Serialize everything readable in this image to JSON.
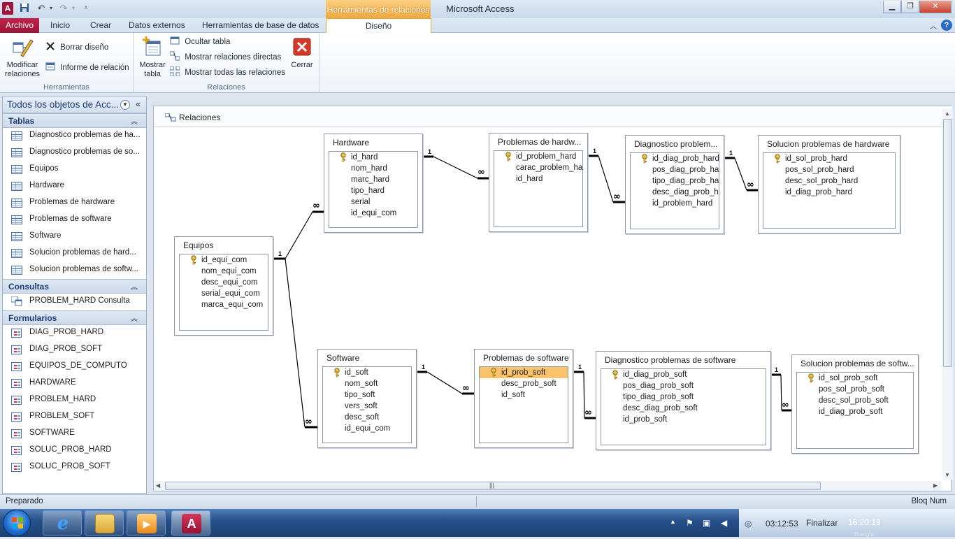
{
  "titlebar": {
    "app_icon_letter": "A",
    "context_tab": "Herramientas de relaciones",
    "app_title": "Microsoft Access",
    "minimize_glyph": "▁",
    "restore_glyph": "❐",
    "close_glyph": "✕"
  },
  "tabs": {
    "archivo": "Archivo",
    "inicio": "Inicio",
    "crear": "Crear",
    "datos_externos": "Datos externos",
    "herramientas_bd": "Herramientas de base de datos",
    "diseno": "Diseño"
  },
  "ribbon": {
    "herramientas": {
      "label": "Herramientas",
      "modificar": "Modificar relaciones",
      "borrar": "Borrar diseño",
      "informe": "Informe de relación"
    },
    "relaciones": {
      "label": "Relaciones",
      "mostrar_tabla": "Mostrar tabla",
      "ocultar": "Ocultar tabla",
      "directas": "Mostrar relaciones directas",
      "todas": "Mostrar todas las relaciones",
      "cerrar": "Cerrar"
    }
  },
  "nav": {
    "title": "Todos los objetos de Acc...",
    "tablas_label": "Tablas",
    "tablas": [
      "Diagnostico problemas de ha...",
      "Diagnostico problemas de so...",
      "Equipos",
      "Hardware",
      "Problemas de hardware",
      "Problemas de software",
      "Software",
      "Solucion problemas de hard...",
      "Solucion problemas de softw..."
    ],
    "consultas_label": "Consultas",
    "consultas": [
      "PROBLEM_HARD Consulta"
    ],
    "formularios_label": "Formularios",
    "formularios": [
      "DIAG_PROB_HARD",
      "DIAG_PROB_SOFT",
      "EQUIPOS_DE_COMPUTO",
      "HARDWARE",
      "PROBLEM_HARD",
      "PROBLEM_SOFT",
      "SOFTWARE",
      "SOLUC_PROB_HARD",
      "SOLUC_PROB_SOFT"
    ]
  },
  "relwin": {
    "tab_label": "Relaciones",
    "one_label": "1",
    "many_label": "∞",
    "tables": {
      "equipos": {
        "title": "Equipos",
        "fields": [
          "id_equi_com",
          "nom_equi_com",
          "desc_equi_com",
          "serial_equi_com",
          "marca_equi_com"
        ]
      },
      "hardware": {
        "title": "Hardware",
        "fields": [
          "id_hard",
          "nom_hard",
          "marc_hard",
          "tipo_hard",
          "serial",
          "id_equi_com"
        ]
      },
      "prob_hard": {
        "title": "Problemas de hardw...",
        "fields": [
          "id_problem_hard",
          "carac_problem_har",
          "id_hard"
        ]
      },
      "diag_hard": {
        "title": "Diagnostico problem...",
        "fields": [
          "id_diag_prob_hard",
          "pos_diag_prob_har",
          "tipo_diag_prob_ha",
          "desc_diag_prob_ha",
          "id_problem_hard"
        ]
      },
      "sol_hard": {
        "title": "Solucion problemas de hardware",
        "fields": [
          "id_sol_prob_hard",
          "pos_sol_prob_hard",
          "desc_sol_prob_hard",
          "id_diag_prob_hard"
        ]
      },
      "software": {
        "title": "Software",
        "fields": [
          "id_soft",
          "nom_soft",
          "tipo_soft",
          "vers_soft",
          "desc_soft",
          "id_equi_com"
        ]
      },
      "prob_soft": {
        "title": "Problemas de software",
        "fields": [
          "id_prob_soft",
          "desc_prob_soft",
          "id_soft"
        ]
      },
      "diag_soft": {
        "title": "Diagnostico problemas de software",
        "fields": [
          "id_diag_prob_soft",
          "pos_diag_prob_soft",
          "tipo_diag_prob_soft",
          "desc_diag_prob_soft",
          "id_prob_soft"
        ]
      },
      "sol_soft": {
        "title": "Solucion problemas de softw...",
        "fields": [
          "id_sol_prob_soft",
          "pos_sol_prob_soft",
          "desc_sol_prob_soft",
          "id_diag_prob_soft"
        ]
      }
    },
    "scroll_grip": "|||"
  },
  "status": {
    "left": "Preparado",
    "right": "Bloq Num"
  },
  "taskbar": {
    "timer": "03:12:53",
    "finalizar": "Finalizar",
    "clock": "16:20:19",
    "clock_sub": "Energía"
  },
  "colors": {
    "accent_archivo": "#a8173d",
    "context_tab": "#f0a93c",
    "selected_field": "#fbc26c"
  }
}
